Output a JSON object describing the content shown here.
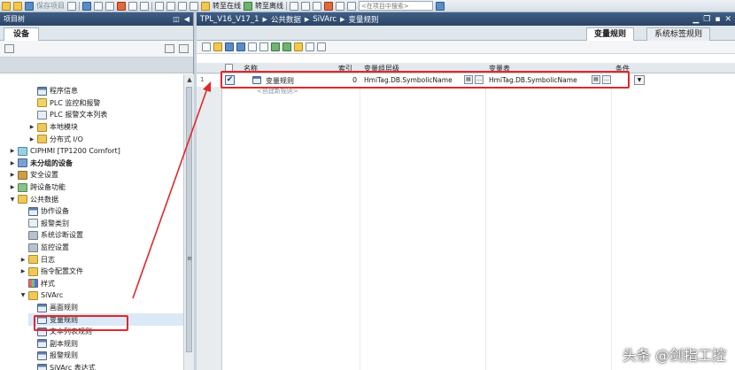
{
  "toolbar": {
    "save_project": "保存项目",
    "go_online": "转至在线",
    "go_offline": "转至离线",
    "search_placeholder": "<在项目中搜索>"
  },
  "project_tree": {
    "title": "项目树",
    "tab": "设备",
    "items": [
      {
        "label": "程序信息",
        "icon": "program-info-icon",
        "level": 3,
        "expander": ""
      },
      {
        "label": "PLC 监控和报警",
        "icon": "plc-alarm-icon",
        "level": 3,
        "expander": ""
      },
      {
        "label": "PLC 报警文本列表",
        "icon": "text-list-icon",
        "level": 3,
        "expander": ""
      },
      {
        "label": "本地模块",
        "icon": "folder-icon",
        "level": 3,
        "expander": "▶"
      },
      {
        "label": "分布式 I/O",
        "icon": "distributed-io-icon",
        "level": 3,
        "expander": "▶"
      },
      {
        "label": "CIPHMI [TP1200 Comfort]",
        "icon": "hmi-device-icon",
        "level": 1,
        "expander": "▶"
      },
      {
        "label": "未分组的设备",
        "icon": "ungrouped-devices-icon",
        "level": 1,
        "expander": "▶",
        "bold": true
      },
      {
        "label": "安全设置",
        "icon": "security-icon",
        "level": 1,
        "expander": "▶"
      },
      {
        "label": "跨设备功能",
        "icon": "cross-device-icon",
        "level": 1,
        "expander": "▶"
      },
      {
        "label": "公共数据",
        "icon": "folder-icon",
        "level": 1,
        "expander": "▼"
      },
      {
        "label": "协作设备",
        "icon": "collab-device-icon",
        "level": 2,
        "expander": ""
      },
      {
        "label": "报警类别",
        "icon": "alarm-class-icon",
        "level": 2,
        "expander": ""
      },
      {
        "label": "系统诊断设置",
        "icon": "diagnostics-icon",
        "level": 2,
        "expander": ""
      },
      {
        "label": "监控设置",
        "icon": "monitor-settings-icon",
        "level": 2,
        "expander": ""
      },
      {
        "label": "日志",
        "icon": "folder-icon",
        "level": 2,
        "expander": "▶"
      },
      {
        "label": "指令配置文件",
        "icon": "folder-icon",
        "level": 2,
        "expander": "▶"
      },
      {
        "label": "样式",
        "icon": "style-icon",
        "level": 2,
        "expander": ""
      },
      {
        "label": "SiVArc",
        "icon": "folder-icon",
        "level": 2,
        "expander": "▼"
      },
      {
        "label": "画面规则",
        "icon": "screen-rules-icon",
        "level": 3,
        "expander": ""
      },
      {
        "label": "变量规则",
        "icon": "tag-rules-icon",
        "level": 3,
        "expander": "",
        "selected": true
      },
      {
        "label": "文本列表规则",
        "icon": "text-list-rules-icon",
        "level": 3,
        "expander": ""
      },
      {
        "label": "副本规则",
        "icon": "copy-rules-icon",
        "level": 3,
        "expander": ""
      },
      {
        "label": "报警规则",
        "icon": "alarm-rules-icon",
        "level": 3,
        "expander": ""
      },
      {
        "label": "SiVArc 表达式",
        "icon": "expression-icon",
        "level": 3,
        "expander": ""
      }
    ]
  },
  "editor": {
    "breadcrumb": [
      "TPL_V16_V17_1",
      "公共数据",
      "SiVArc",
      "变量规则"
    ],
    "tabs": [
      "变量规则",
      "系统标签规则"
    ],
    "columns": {
      "name": "名称",
      "index": "索引",
      "tag_group": "变量组层级",
      "tag_table": "变量表",
      "condition": "条件"
    },
    "row": {
      "number": "1",
      "checked": true,
      "name": "变量规则",
      "index": "0",
      "tag_group": "HmiTag.DB.SymbolicName",
      "tag_table": "HmiTag.DB.SymbolicName"
    },
    "add_new": "<创建新规则>"
  },
  "watermark": "头条 @剑指工控",
  "colors": {
    "title_bar": "#2b4466",
    "highlight": "#e0282c"
  }
}
